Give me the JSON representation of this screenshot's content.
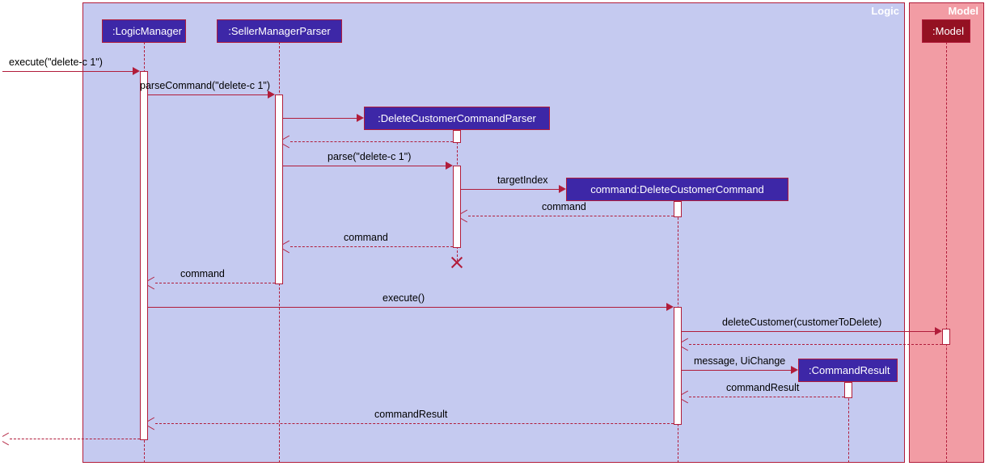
{
  "frames": {
    "logic": "Logic",
    "model": "Model"
  },
  "participants": {
    "logicManager": ":LogicManager",
    "sellerManagerParser": ":SellerManagerParser",
    "deleteCustomerCommandParser": ":DeleteCustomerCommandParser",
    "deleteCustomerCommand": "command:DeleteCustomerCommand",
    "commandResult": ":CommandResult",
    "model": ":Model"
  },
  "messages": {
    "m1": "execute(\"delete-c 1\")",
    "m2": "parseCommand(\"delete-c 1\")",
    "m3_return": "",
    "m4": "parse(\"delete-c 1\")",
    "m5": "targetIndex",
    "m6": "command",
    "m7": "command",
    "m8": "command",
    "m9": "execute()",
    "m10": "deleteCustomer(customerToDelete)",
    "m11_return": "",
    "m12": "message, UiChange",
    "m13": "commandResult",
    "m14": "commandResult",
    "m15_return": ""
  },
  "colors": {
    "logic_bg": "#c5caf0",
    "model_bg": "#f29ca4",
    "participant_fill": "#3d27a7",
    "model_participant_fill": "#941122",
    "stroke": "#b11c3a"
  }
}
